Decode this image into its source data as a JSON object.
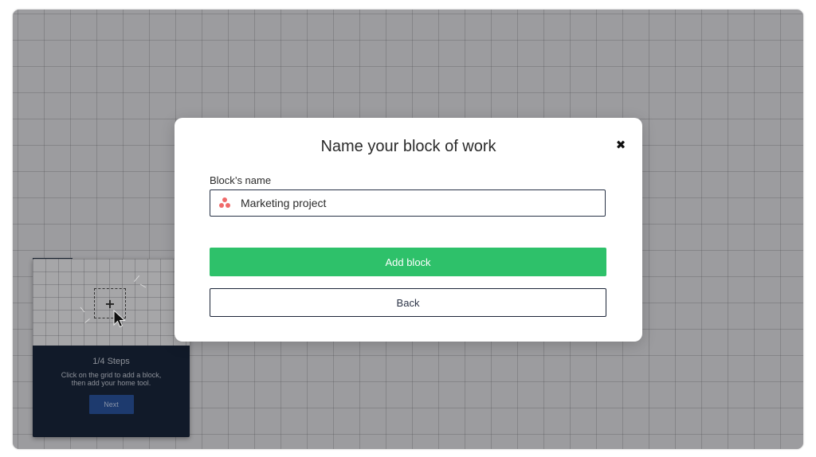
{
  "modal": {
    "title": "Name your block of work",
    "close_glyph": "✖",
    "field_label": "Block’s name",
    "field_value": "Marketing project",
    "field_icon": "asana-logo-icon",
    "add_button_label": "Add block",
    "back_button_label": "Back"
  },
  "tutorial": {
    "preview_plus": "+",
    "steps_title": "1/4 Steps",
    "steps_description": "Click on the grid to add a block, then add your home tool.",
    "next_button_label": "Next"
  },
  "colors": {
    "primary_green": "#2ec16a",
    "dark_navy": "#1c2538",
    "asana_red": "#f06a6a",
    "grid_background": "#a9a9ab"
  }
}
